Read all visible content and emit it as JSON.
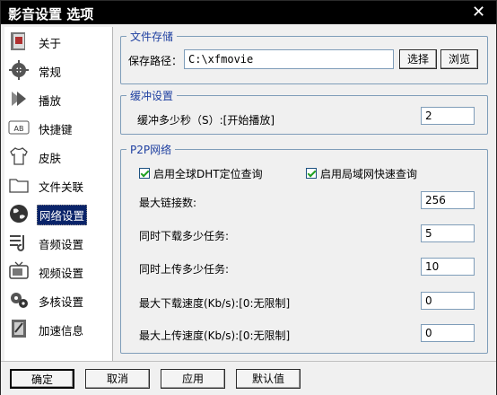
{
  "window": {
    "title": "影音设置 选项",
    "close_glyph": "✕"
  },
  "sidebar": {
    "items": [
      {
        "label": "关于",
        "icon": "about-icon"
      },
      {
        "label": "常规",
        "icon": "gear-icon"
      },
      {
        "label": "播放",
        "icon": "play-icon"
      },
      {
        "label": "快捷键",
        "icon": "keyboard-icon"
      },
      {
        "label": "皮肤",
        "icon": "shirt-icon"
      },
      {
        "label": "文件关联",
        "icon": "folder-icon"
      },
      {
        "label": "网络设置",
        "icon": "globe-icon"
      },
      {
        "label": "音频设置",
        "icon": "audio-icon"
      },
      {
        "label": "视频设置",
        "icon": "tv-icon"
      },
      {
        "label": "多核设置",
        "icon": "multicore-icon"
      },
      {
        "label": "加速信息",
        "icon": "accel-icon"
      }
    ],
    "active_index": 6
  },
  "storage": {
    "title": "文件存储",
    "path_label": "保存路径：",
    "path_value": "C:\\xfmovie",
    "choose_label": "选择",
    "browse_label": "浏览"
  },
  "buffer": {
    "title": "缓冲设置",
    "seconds_label": "缓冲多少秒（S）:[开始播放]",
    "seconds_value": "2"
  },
  "p2p": {
    "title": "P2P网络",
    "dht_label": "启用全球DHT定位查询",
    "dht_checked": true,
    "lan_label": "启用局域网快速查询",
    "lan_checked": true,
    "max_links_label": "最大链接数:",
    "max_links_value": "256",
    "dl_tasks_label": "同时下载多少任务:",
    "dl_tasks_value": "5",
    "ul_tasks_label": "同时上传多少任务:",
    "ul_tasks_value": "10",
    "max_dl_label": "最大下载速度(Kb/s):[0:无限制]",
    "max_dl_value": "0",
    "max_ul_label": "最大上传速度(Kb/s):[0:无限制]",
    "max_ul_value": "0"
  },
  "footer": {
    "ok_label": "确定",
    "cancel_label": "取消",
    "apply_label": "应用",
    "default_label": "默认值"
  }
}
